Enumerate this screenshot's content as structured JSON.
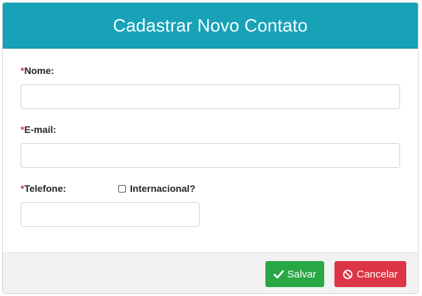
{
  "header": {
    "title": "Cadastrar Novo Contato"
  },
  "form": {
    "required_mark": "*",
    "nome": {
      "label": "Nome:",
      "value": ""
    },
    "email": {
      "label": "E-mail:",
      "value": ""
    },
    "telefone": {
      "label": "Telefone:",
      "value": ""
    },
    "internacional": {
      "label": "Internacional?",
      "checked": false
    }
  },
  "footer": {
    "save_label": "Salvar",
    "cancel_label": "Cancelar"
  },
  "colors": {
    "header_bg": "#17a2b8",
    "required": "#dc3545",
    "save": "#28a745",
    "cancel": "#dc3545"
  },
  "icons": {
    "save": "check-icon",
    "cancel": "ban-icon"
  }
}
